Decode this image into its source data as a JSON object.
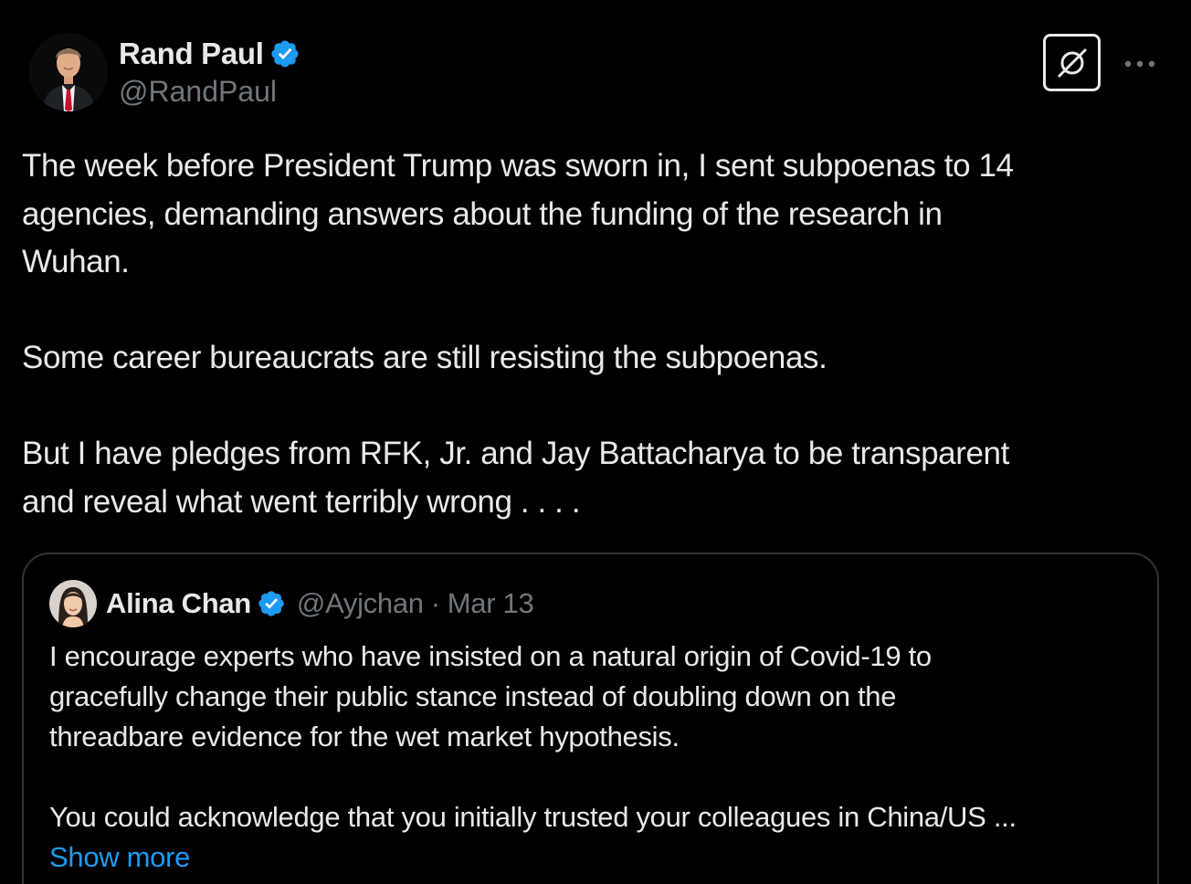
{
  "tweet": {
    "author": {
      "display_name": "Rand Paul",
      "handle": "@RandPaul",
      "verified": true,
      "avatar_icon": "avatar-rand-paul"
    },
    "paragraphs": [
      [
        "The week before President Trump was sworn in, I sent subpoenas to 14",
        "agencies, demanding answers about the funding of the research in",
        "Wuhan."
      ],
      [
        "Some career bureaucrats are still resisting the subpoenas."
      ],
      [
        "But I have pledges from RFK, Jr. and Jay Battacharya to be transparent",
        "and reveal what went terribly wrong . . . ."
      ]
    ],
    "actions": {
      "grok_icon": "grok-icon",
      "more_icon": "more-icon"
    }
  },
  "quote": {
    "author": {
      "display_name": "Alina Chan",
      "handle": "@Ayjchan",
      "separator": "·",
      "date": "Mar 13",
      "verified": true
    },
    "paragraphs": [
      [
        "I encourage experts who have insisted on a natural origin of Covid-19 to",
        "gracefully change their public stance instead of doubling down on the",
        "threadbare evidence for the wet market hypothesis."
      ],
      [
        "You could acknowledge that you initially trusted your colleagues in China/US ..."
      ]
    ],
    "show_more": "Show more"
  },
  "colors": {
    "background": "#000000",
    "text": "#e7e9ea",
    "secondary": "#71767b",
    "accent": "#1d9bf0",
    "border": "#2f3336"
  }
}
